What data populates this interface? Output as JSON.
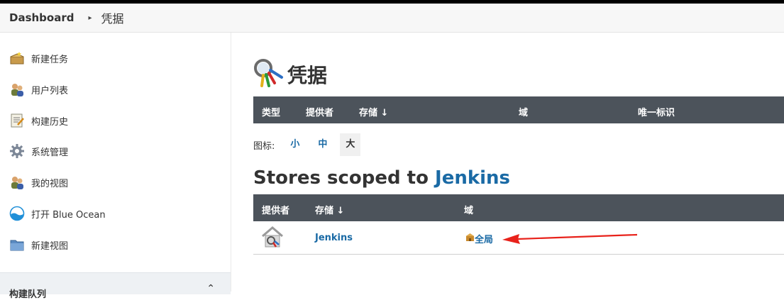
{
  "breadcrumb": {
    "home": "Dashboard",
    "separator": "▸",
    "current": "凭据"
  },
  "sidebar": {
    "items": [
      {
        "label": "新建任务",
        "icon": "new-item-icon"
      },
      {
        "label": "用户列表",
        "icon": "users-icon"
      },
      {
        "label": "构建历史",
        "icon": "build-history-icon"
      },
      {
        "label": "系统管理",
        "icon": "gear-icon"
      },
      {
        "label": "我的视图",
        "icon": "my-views-icon"
      },
      {
        "label": "打开 Blue Ocean",
        "icon": "blue-ocean-icon"
      },
      {
        "label": "新建视图",
        "icon": "folder-icon"
      }
    ],
    "queue": {
      "title": "构建队列",
      "toggle": "⌃"
    }
  },
  "main": {
    "title": "凭据",
    "credentials_table": {
      "headers": [
        "类型",
        "提供者",
        "存储 ↓",
        "域",
        "唯一标识"
      ]
    },
    "icon_size": {
      "label": "图标:",
      "options": [
        "小",
        "中",
        "大"
      ],
      "selected": "大"
    },
    "stores_heading": {
      "prefix": "Stores scoped to ",
      "link": "Jenkins"
    },
    "stores_table": {
      "headers": [
        "提供者",
        "存储 ↓",
        "域"
      ],
      "rows": [
        {
          "provider_icon": "jenkins-store-icon",
          "store": "Jenkins",
          "domain": "全局"
        }
      ]
    }
  },
  "colors": {
    "table_header": "#4c535b",
    "link": "#1a6aa5",
    "arrow": "#e8221b"
  }
}
